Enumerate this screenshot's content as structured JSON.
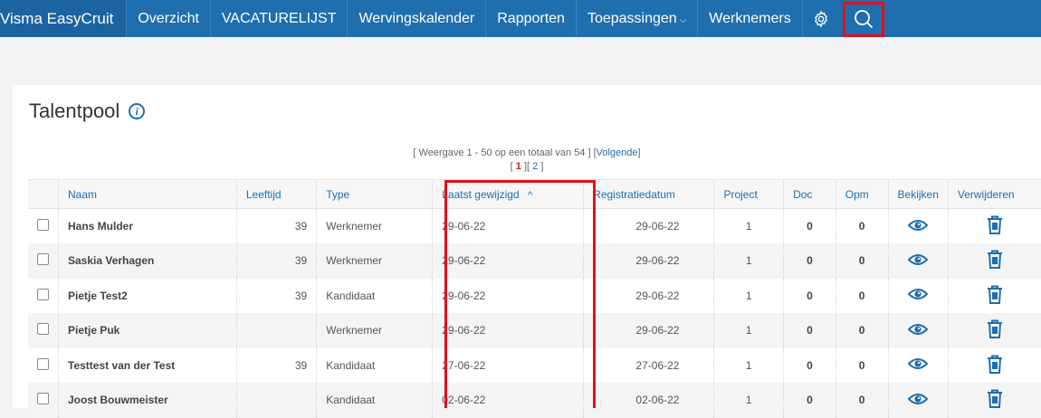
{
  "nav": {
    "brand": "Visma EasyCruit",
    "items": [
      "Overzicht",
      "VACATURELIJST",
      "Wervingskalender",
      "Rapporten",
      "Toepassingen",
      "Werknemers"
    ],
    "toepassingen_chevron": "⌵",
    "gear_icon": "gear-icon",
    "search_icon": "search-icon"
  },
  "page": {
    "title": "Talentpool",
    "info_icon": "i"
  },
  "paging": {
    "prefix": "[ Weergave 1 - 50 op een totaal van 54 ]",
    "next_open": "[",
    "next_label": "Volgende",
    "next_close": "]",
    "page1_open": "[",
    "page1": "1",
    "page1_close": "]",
    "page2_open": "[",
    "page2": "2",
    "page2_close": "]"
  },
  "table": {
    "headers": {
      "naam": "Naam",
      "leeftijd": "Leeftijd",
      "type": "Type",
      "laatst": "Laatst gewijzigd",
      "sort_arrow": "^",
      "registratie": "Registratiedatum",
      "project": "Project",
      "doc": "Doc",
      "opm": "Opm",
      "bekijken": "Bekijken",
      "verwijderen": "Verwijderen"
    },
    "rows": [
      {
        "naam": "Hans Mulder",
        "leeftijd": "39",
        "type": "Werknemer",
        "laatst": "29-06-22",
        "registratie": "29-06-22",
        "project": "1",
        "doc": "0",
        "opm": "0"
      },
      {
        "naam": "Saskia Verhagen",
        "leeftijd": "39",
        "type": "Werknemer",
        "laatst": "29-06-22",
        "registratie": "29-06-22",
        "project": "1",
        "doc": "0",
        "opm": "0"
      },
      {
        "naam": "Pietje Test2",
        "leeftijd": "39",
        "type": "Kandidaat",
        "laatst": "29-06-22",
        "registratie": "29-06-22",
        "project": "1",
        "doc": "0",
        "opm": "0"
      },
      {
        "naam": "Pietje Puk",
        "leeftijd": "",
        "type": "Werknemer",
        "laatst": "29-06-22",
        "registratie": "29-06-22",
        "project": "1",
        "doc": "0",
        "opm": "0"
      },
      {
        "naam": "Testtest van der Test",
        "leeftijd": "39",
        "type": "Kandidaat",
        "laatst": "27-06-22",
        "registratie": "27-06-22",
        "project": "1",
        "doc": "0",
        "opm": "0"
      },
      {
        "naam": "Joost Bouwmeister",
        "leeftijd": "",
        "type": "Kandidaat",
        "laatst": "02-06-22",
        "registratie": "02-06-22",
        "project": "1",
        "doc": "0",
        "opm": "0"
      }
    ]
  },
  "colors": {
    "nav_bg": "#1f6eae",
    "highlight": "#e0101e",
    "link": "#1f6eae"
  }
}
